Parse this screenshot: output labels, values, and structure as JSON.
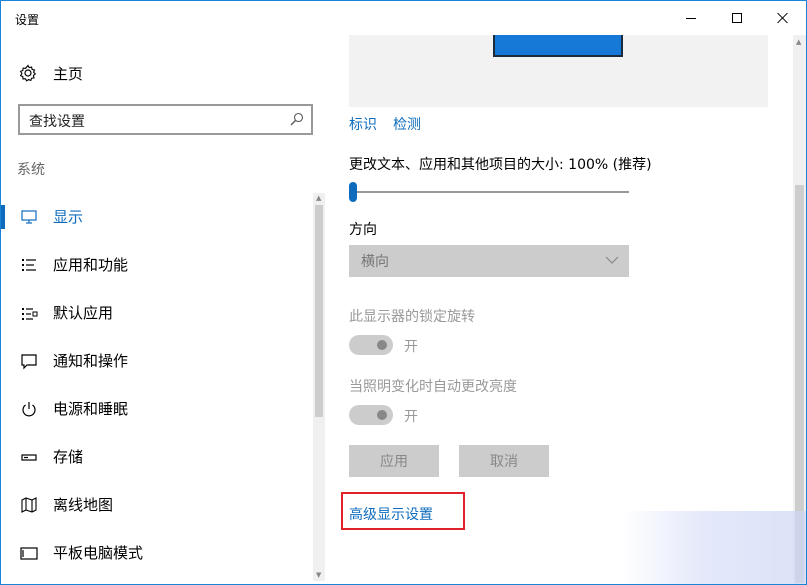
{
  "window": {
    "title": "设置"
  },
  "nav": {
    "home_label": "主页",
    "search_placeholder": "查找设置",
    "section_title": "系统",
    "items": [
      {
        "label": "显示",
        "icon": "monitor-icon",
        "active": true
      },
      {
        "label": "应用和功能",
        "icon": "list-icon"
      },
      {
        "label": "默认应用",
        "icon": "default-apps-icon"
      },
      {
        "label": "通知和操作",
        "icon": "notification-icon"
      },
      {
        "label": "电源和睡眠",
        "icon": "power-icon"
      },
      {
        "label": "存储",
        "icon": "storage-icon"
      },
      {
        "label": "离线地图",
        "icon": "map-icon"
      },
      {
        "label": "平板电脑模式",
        "icon": "tablet-icon"
      }
    ]
  },
  "display": {
    "identify_link": "标识",
    "detect_link": "检测",
    "scale_label": "更改文本、应用和其他项目的大小: 100% (推荐)",
    "scale_value": 100,
    "orientation_label": "方向",
    "orientation_value": "横向",
    "rotation_lock_label": "此显示器的锁定旋转",
    "rotation_lock_state": "开",
    "auto_brightness_label": "当照明变化时自动更改亮度",
    "auto_brightness_state": "开",
    "apply_button": "应用",
    "cancel_button": "取消",
    "advanced_link": "高级显示设置"
  },
  "colors": {
    "accent": "#0f6cbd",
    "highlight_box": "#e0232a",
    "window_border": "#1883d7"
  }
}
